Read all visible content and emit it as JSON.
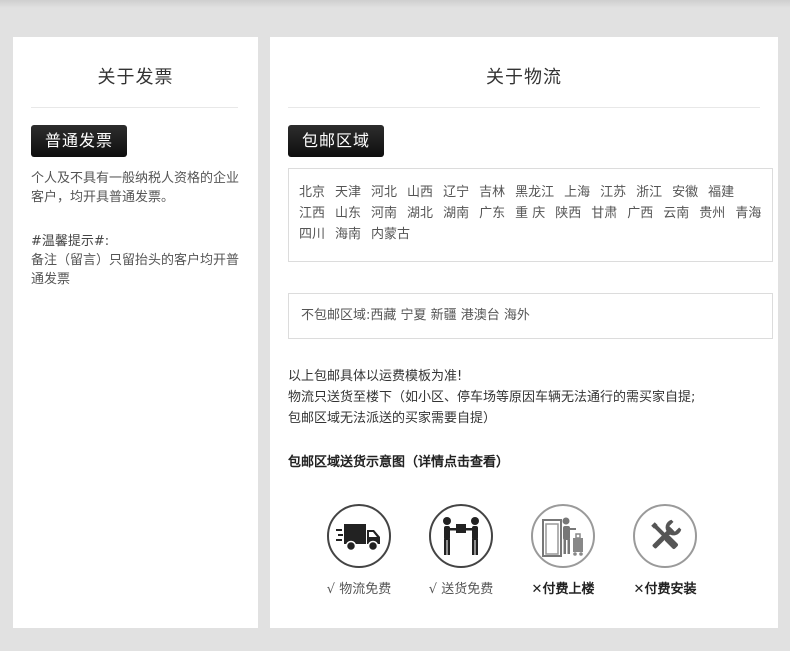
{
  "invoice": {
    "title": "关于发票",
    "tag": "普通发票",
    "text": "个人及不具有一般纳税人资格的企业客户，均开具普通发票。",
    "tip_label": "#温馨提示#:",
    "tip_text": "备注（留言）只留抬头的客户均开普通发票"
  },
  "logistics": {
    "title": "关于物流",
    "tag": "包邮区域",
    "regions": [
      "北京",
      "天津",
      "河北",
      "山西",
      "辽宁",
      "吉林",
      "黑龙江",
      "上海",
      "江苏",
      "浙江",
      "安徽",
      "福建",
      "江西",
      "山东",
      "河南",
      "湖北",
      "湖南",
      "广东",
      "重 庆",
      "陕西",
      "甘肃",
      "广西",
      "云南",
      "贵州",
      "青海",
      "四川",
      "海南",
      "内蒙古"
    ],
    "excluded": "不包邮区域:西藏 宁夏 新疆 港澳台 海外",
    "notes": [
      "以上包邮具体以运费模板为准!",
      "物流只送货至楼下（如小区、停车场等原因车辆无法通行的需买家自提;",
      "包邮区域无法派送的买家需要自提）"
    ],
    "diagram_title": "包邮区域送货示意图（详情点击查看）",
    "services": [
      {
        "caption": "√ 物流免费",
        "icon": "truck-icon"
      },
      {
        "caption": "√ 送货免费",
        "icon": "handover-icon"
      },
      {
        "caption": "✕付费上楼",
        "icon": "stairs-icon"
      },
      {
        "caption": "✕付费安装",
        "icon": "tools-icon"
      }
    ]
  }
}
